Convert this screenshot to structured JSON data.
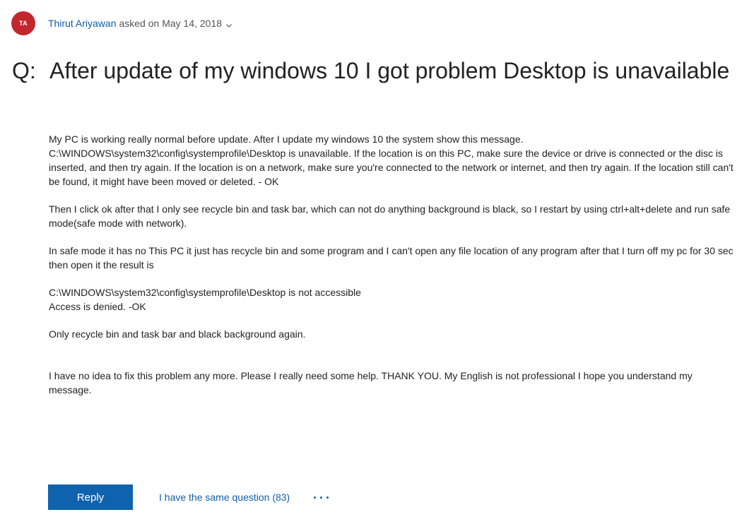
{
  "question": {
    "avatar_initials": "TA",
    "author": "Thirut Ariyawan",
    "asked_on": "asked on May 14, 2018",
    "title_prefix": "Q:",
    "title": "After update of my windows 10 I got problem Desktop is unavailable",
    "body": {
      "p1_line1": "My PC is working really normal before update. After I update my windows 10 the system show this message.",
      "p1_line2": "C:\\WINDOWS\\system32\\config\\systemprofile\\Desktop is unavailable. If the location is on this PC, make sure the device or drive is connected or the disc is inserted, and then try again. If the location is on a network, make sure you're connected to the network or internet, and then try again. If the location still can't be found, it might have been moved or deleted. - OK",
      "p2": "Then I click ok after that I only see recycle bin and task bar, which can not do anything background is black, so I restart by using ctrl+alt+delete and run safe mode(safe mode with network).",
      "p3": "In safe mode it has no This PC it just has recycle bin and some program and I can't open any file location of any program after that I turn off my pc for 30 sec then open it the result is",
      "p4_line1": "C:\\WINDOWS\\system32\\config\\systemprofile\\Desktop is not accessible",
      "p4_line2": "Access is denied. -OK",
      "p5": "Only recycle bin and task bar and black background again.",
      "p6": "I have no idea to fix this problem any more. Please I really need some help. THANK YOU. My English is not professional I hope you understand my message."
    }
  },
  "actions": {
    "reply_label": "Reply",
    "same_question_label": "I have the same question (83)"
  },
  "colors": {
    "accent": "#0f62ad",
    "link": "#0f5fa8",
    "avatar_bg": "#c4262e"
  },
  "icons": {
    "meta_menu": "chevron-down-icon",
    "more": "more-options-icon"
  }
}
